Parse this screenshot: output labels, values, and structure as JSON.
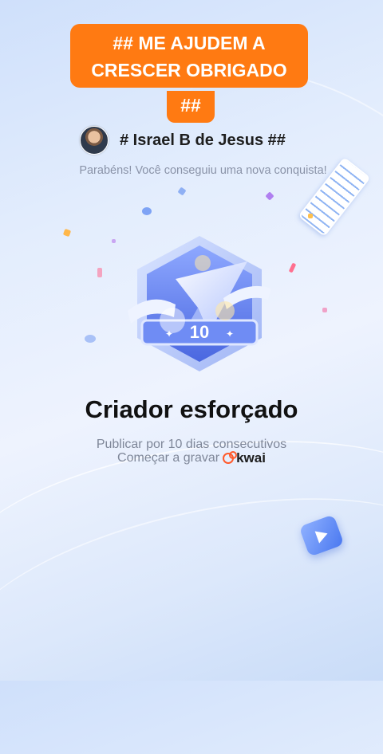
{
  "overlay_caption": {
    "line1": "## ME AJUDEM A",
    "line2": "CRESCER OBRIGADO",
    "line3": "##"
  },
  "user": {
    "name": "# Israel B de Jesus ##"
  },
  "congrats_text": "Parabéns! Você conseguiu uma nova conquista!",
  "badge": {
    "number": "10",
    "icons": [
      "paper-plane-icon",
      "ribbon-icon",
      "star-sparkle-icon"
    ]
  },
  "achievement": {
    "title": "Criador esforçado",
    "description": "Publicar por 10 dias consecutivos",
    "cta": "Começar a gravar",
    "brand": "kwai"
  },
  "colors": {
    "caption_bg": "#ff7a12",
    "badge_blue": "#5a7df0",
    "brand_orange": "#ff5a2c"
  }
}
